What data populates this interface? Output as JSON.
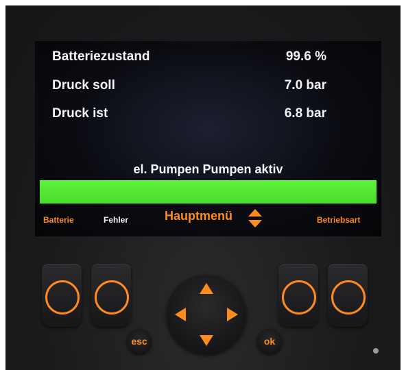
{
  "display": {
    "rows": [
      {
        "label": "Batteriezustand",
        "value": "99.6 %"
      },
      {
        "label": "Druck soll",
        "value": "7.0 bar"
      },
      {
        "label": "Druck ist",
        "value": "6.8 bar"
      }
    ],
    "status_text": "el. Pumpen Pumpen aktiv",
    "progress_fraction": 1.0,
    "softkeys": {
      "key1": "Batterie",
      "key2": "Fehler",
      "center": "Hauptmenü",
      "key4": "Betriebsart"
    }
  },
  "keypad": {
    "esc_label": "esc",
    "ok_label": "ok"
  },
  "colors": {
    "accent_orange": "#ff8a1e",
    "progress_green": "#52e633",
    "text_white": "#f2f4f7"
  },
  "icons": {
    "updown": "updown-arrows-icon",
    "dpad_up": "arrow-up-icon",
    "dpad_down": "arrow-down-icon",
    "dpad_left": "arrow-left-icon",
    "dpad_right": "arrow-right-icon"
  }
}
